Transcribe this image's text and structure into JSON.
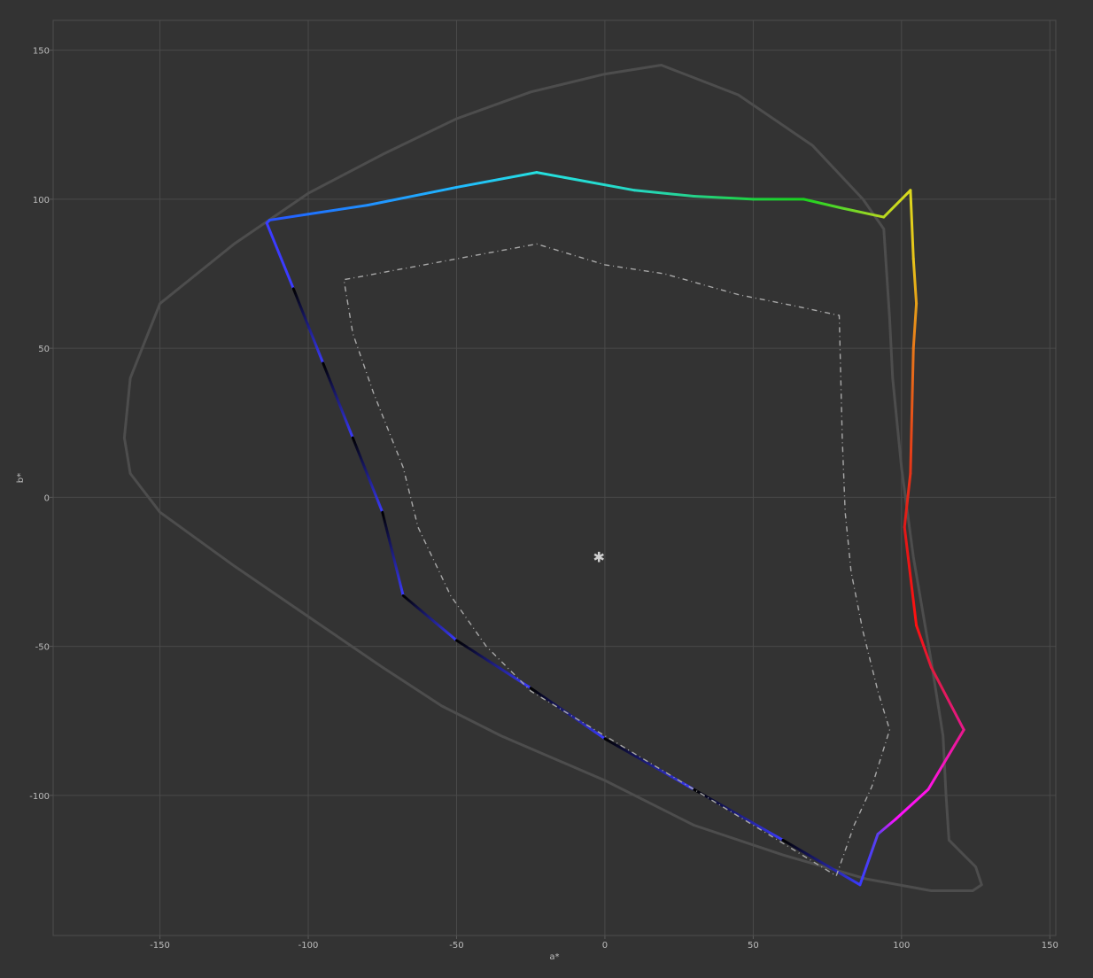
{
  "chart_data": {
    "type": "line",
    "title": "",
    "xlabel": "a*",
    "ylabel": "b*",
    "xlim": [
      -186,
      152
    ],
    "ylim": [
      -147,
      160
    ],
    "xticks": [
      -150,
      -100,
      -50,
      0,
      50,
      100,
      150
    ],
    "yticks": [
      150,
      100,
      50,
      0,
      -50,
      -100
    ],
    "grid": true,
    "background_color": "#333333",
    "series": [
      {
        "style": "outer-boundary",
        "color": "#4d4d4d",
        "closed": true,
        "points": [
          [
            19,
            145
          ],
          [
            45,
            135
          ],
          [
            70,
            118
          ],
          [
            87,
            100
          ],
          [
            94,
            90
          ],
          [
            96,
            60
          ],
          [
            97,
            40
          ],
          [
            100,
            10
          ],
          [
            104,
            -20
          ],
          [
            110,
            -55
          ],
          [
            114,
            -80
          ],
          [
            115,
            -100
          ],
          [
            116,
            -115
          ],
          [
            120,
            -119
          ],
          [
            125,
            -124
          ],
          [
            127,
            -130
          ],
          [
            124,
            -132
          ],
          [
            110,
            -132
          ],
          [
            88,
            -128
          ],
          [
            60,
            -120
          ],
          [
            30,
            -110
          ],
          [
            0,
            -95
          ],
          [
            -35,
            -80
          ],
          [
            -55,
            -70
          ],
          [
            -75,
            -57
          ],
          [
            -100,
            -40
          ],
          [
            -125,
            -23
          ],
          [
            -150,
            -5
          ],
          [
            -160,
            8
          ],
          [
            -162,
            20
          ],
          [
            -160,
            40
          ],
          [
            -150,
            65
          ],
          [
            -125,
            85
          ],
          [
            -100,
            102
          ],
          [
            -75,
            115
          ],
          [
            -50,
            127
          ],
          [
            -25,
            136
          ],
          [
            0,
            142
          ],
          [
            19,
            145
          ]
        ]
      },
      {
        "style": "gamut-gradient",
        "closed": false,
        "points": [
          [
            86,
            -130
          ],
          [
            92,
            -113
          ],
          [
            98,
            -108
          ],
          [
            109,
            -98
          ],
          [
            121,
            -78
          ],
          [
            110,
            -57
          ],
          [
            105,
            -43
          ],
          [
            101,
            -10
          ],
          [
            103,
            8
          ],
          [
            104,
            50
          ],
          [
            105,
            65
          ],
          [
            104,
            80
          ],
          [
            103,
            103
          ],
          [
            94,
            94
          ],
          [
            80,
            97
          ],
          [
            67,
            100
          ],
          [
            50,
            100
          ],
          [
            30,
            101
          ],
          [
            10,
            103
          ],
          [
            -23,
            109
          ],
          [
            -50,
            104
          ],
          [
            -80,
            98
          ],
          [
            -100,
            95
          ],
          [
            -113,
            93
          ],
          [
            -114,
            92
          ],
          [
            -105,
            70
          ],
          [
            -95,
            45
          ],
          [
            -85,
            20
          ],
          [
            -75,
            -5
          ],
          [
            -68,
            -33
          ],
          [
            -50,
            -48
          ],
          [
            -25,
            -64
          ],
          [
            0,
            -81
          ],
          [
            30,
            -98
          ],
          [
            60,
            -115
          ],
          [
            86,
            -130
          ]
        ],
        "stops": [
          "#3b3bff",
          "#5b3ff0",
          "#ff10ff",
          "#ff14e6",
          "#e8188c",
          "#e01a3c",
          "#ff1010",
          "#e01818",
          "#e63418",
          "#e8781a",
          "#e6a019",
          "#e8c41a",
          "#dcd81e",
          "#b8d81e",
          "#5ad62a",
          "#1ad21e",
          "#1ed240",
          "#25d28a",
          "#25d8c4",
          "#25e0e0",
          "#20b8ff",
          "#2090ff",
          "#1e72ff",
          "#2a50ff",
          "#3b3bff"
        ]
      },
      {
        "style": "reference-dashed",
        "color": "#a8a8a8",
        "closed": false,
        "points": [
          [
            78,
            -127
          ],
          [
            84,
            -110
          ],
          [
            90,
            -97
          ],
          [
            96,
            -78
          ],
          [
            92,
            -65
          ],
          [
            87,
            -45
          ],
          [
            83,
            -25
          ],
          [
            81,
            -5
          ],
          [
            80,
            20
          ],
          [
            79,
            61
          ],
          [
            65,
            64
          ],
          [
            45,
            68
          ],
          [
            20,
            75
          ],
          [
            0,
            78
          ],
          [
            -23,
            85
          ],
          [
            -50,
            80
          ],
          [
            -88,
            73
          ],
          [
            -85,
            55
          ],
          [
            -78,
            35
          ],
          [
            -68,
            10
          ],
          [
            -63,
            -10
          ],
          [
            -52,
            -33
          ],
          [
            -40,
            -50
          ],
          [
            -25,
            -65
          ],
          [
            0,
            -80
          ],
          [
            25,
            -95
          ],
          [
            55,
            -113
          ],
          [
            78,
            -127
          ]
        ]
      },
      {
        "style": "marker",
        "color": "#cfcfcf",
        "symbol": "✱",
        "points": [
          [
            -2,
            -20
          ]
        ]
      }
    ]
  }
}
